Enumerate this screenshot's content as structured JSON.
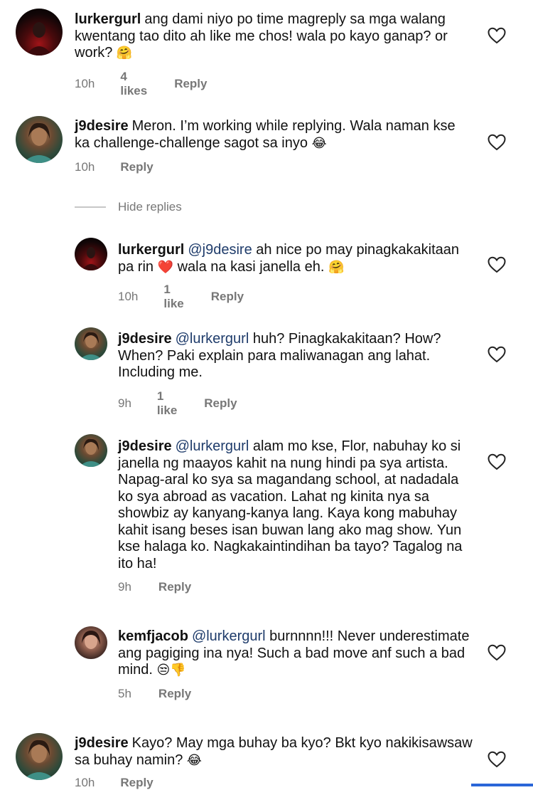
{
  "comments": [
    {
      "username": "lurkergurl",
      "text": "ang dami niyo po time magreply sa mga walang kwentang tao dito ah like me chos! wala po kayo ganap? or work?",
      "emoji": "🤗",
      "time": "10h",
      "likes": "4 likes",
      "reply": "Reply"
    },
    {
      "username": "j9desire",
      "text": "Meron. I’m working while replying. Wala naman kse ka challenge-challenge sagot sa inyo",
      "emoji": "😂",
      "time": "10h",
      "reply": "Reply"
    },
    {
      "username": "lurkergurl",
      "mention": "@j9desire",
      "text": "ah nice po may pinagkakakitaan pa rin",
      "heart": "❤️",
      "text2": "wala na kasi janella eh.",
      "emoji": "🤗",
      "time": "10h",
      "likes": "1 like",
      "reply": "Reply"
    },
    {
      "username": "j9desire",
      "mention": "@lurkergurl",
      "text": "huh? Pinagkakakitaan? How? When? Paki explain para maliwanagan ang lahat. Including me.",
      "time": "9h",
      "likes": "1 like",
      "reply": "Reply"
    },
    {
      "username": "j9desire",
      "mention": "@lurkergurl",
      "text": "alam mo kse, Flor, nabuhay ko si janella ng maayos kahit na nung hindi pa sya artista. Napag-aral ko sya sa magandang school, at nadadala ko sya abroad as vacation. Lahat ng kinita nya sa showbiz ay kanyang-kanya lang. Kaya kong mabuhay kahit isang beses isan buwan lang ako mag show. Yun kse halaga ko. Nagkakaintindihan ba tayo? Tagalog na ito ha!",
      "time": "9h",
      "reply": "Reply"
    },
    {
      "username": "kemfjacob",
      "mention": "@lurkergurl",
      "text": "burnnnn!!! Never underestimate ang pagiging ina nya! Such a bad move anf such a bad mind.",
      "emoji": "😒👎",
      "time": "5h",
      "reply": "Reply"
    },
    {
      "username": "j9desire",
      "text": "Kayo? May mga buhay ba kyo? Bkt kyo nakikisawsaw sa buhay namin?",
      "emoji": "😂",
      "time": "10h",
      "reply": "Reply"
    }
  ],
  "hide_replies": "Hide replies",
  "icons": {
    "like": "heart-outline-icon"
  },
  "colors": {
    "mention": "#1f3c6b",
    "meta": "#777777",
    "bottom_bar": "#2a66d8"
  }
}
